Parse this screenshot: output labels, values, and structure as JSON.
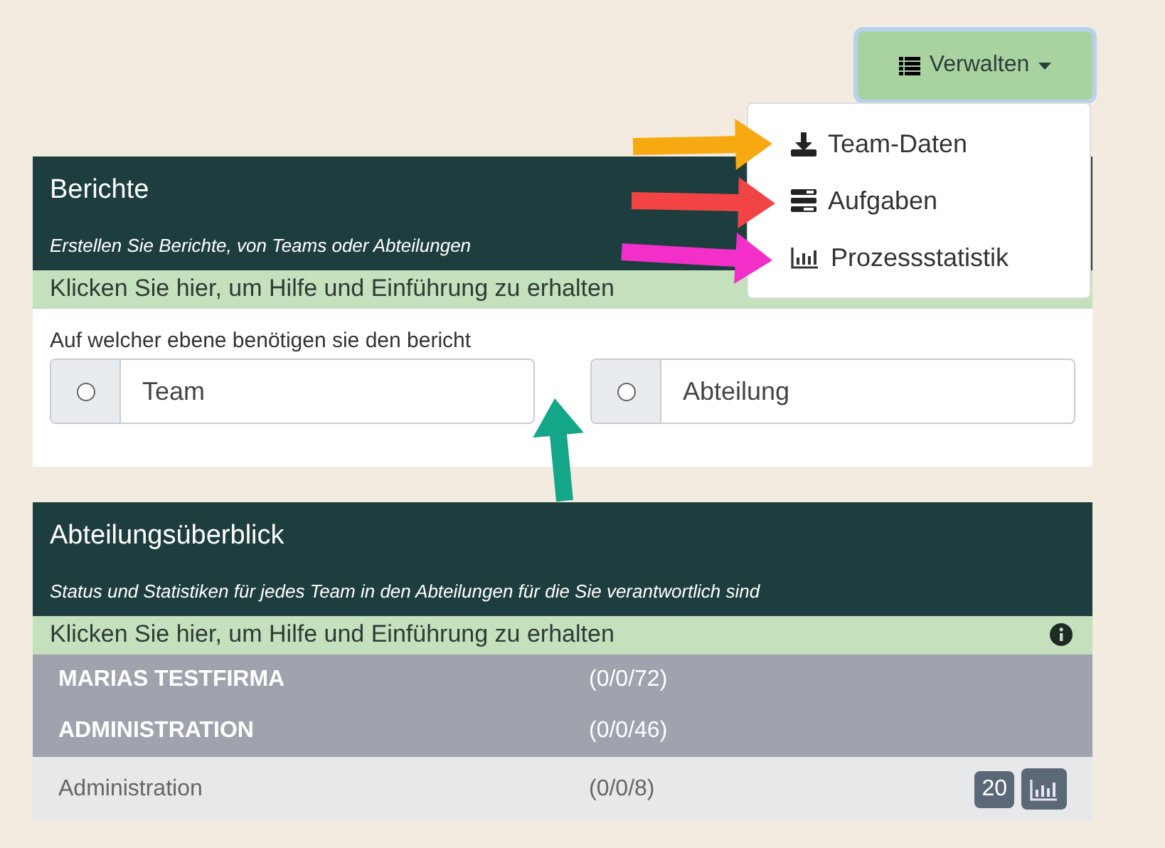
{
  "manage_button": {
    "label": "Verwalten",
    "expanded": true
  },
  "manage_menu": [
    {
      "kind": "download",
      "label": "Team-Daten",
      "arrow": {
        "color": "#f7a912"
      }
    },
    {
      "kind": "tasks",
      "label": "Aufgaben",
      "arrow": {
        "color": "#f24444"
      }
    },
    {
      "kind": "stats",
      "label": "Prozessstatistik",
      "arrow": {
        "color": "#f22fc9"
      }
    }
  ],
  "reports_card": {
    "title": "Berichte",
    "subtitle": "Erstellen Sie Berichte, von Teams oder Abteilungen",
    "help": "Klicken Sie hier, um Hilfe und Einführung zu erhalten",
    "question": "Auf welcher ebene benötigen sie den bericht",
    "options": [
      {
        "label": "Team",
        "selected": false
      },
      {
        "label": "Abteilung",
        "selected": false
      }
    ],
    "arrow": {
      "color": "#14a688"
    }
  },
  "overview_card": {
    "title": "Abteilungsüberblick",
    "subtitle": "Status und Statistiken für jedes Team in den Abteilungen für die Sie verantwortlich sind",
    "help": "Klicken Sie hier, um Hilfe und Einführung zu erhalten",
    "rows": [
      {
        "kind": "company",
        "name": "MARIAS TESTFIRMA",
        "count": "(0/0/72)"
      },
      {
        "kind": "department",
        "name": "ADMINISTRATION",
        "count": "(0/0/46)"
      },
      {
        "kind": "team",
        "name": "Administration",
        "count": "(0/0/8)",
        "badge": "20"
      }
    ]
  }
}
